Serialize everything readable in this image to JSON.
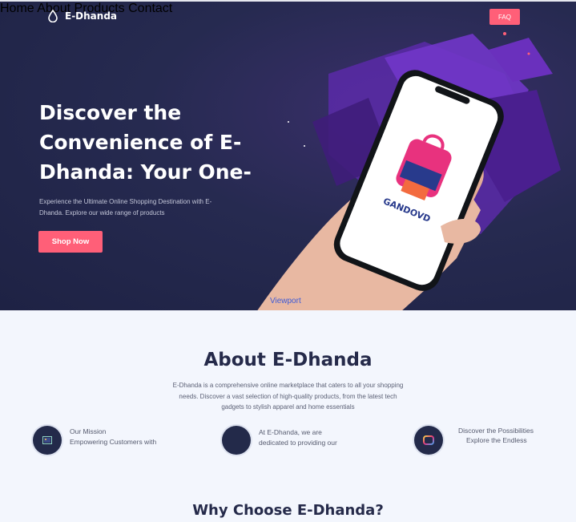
{
  "header": {
    "brand": "E-Dhanda",
    "nav": [
      "Home",
      "About",
      "Products",
      "Contact"
    ],
    "faq": "FAQ"
  },
  "hero": {
    "title": "Discover the Convenience of E-Dhanda: Your One-",
    "subtitle": "Experience the Ultimate Online Shopping Destination with E-Dhanda. Explore our wide range of products",
    "cta": "Shop Now",
    "viewport_label": "Viewport"
  },
  "about": {
    "title": "About E-Dhanda",
    "text": "E-Dhanda is a comprehensive online marketplace that caters to all your shopping needs. Discover a vast selection of high-quality products, from the latest tech gadgets to stylish apparel and home essentials",
    "features": [
      {
        "title": "Our Mission",
        "text": "Empowering Customers with",
        "icon": "image-icon"
      },
      {
        "title": "At E-Dhanda, we are",
        "text": "dedicated to providing our",
        "icon": "circle-icon"
      },
      {
        "title": "Discover the Possibilities",
        "text": "Explore the Endless",
        "icon": "gradient-square-icon"
      }
    ]
  },
  "why": {
    "title": "Why Choose E-Dhanda?"
  },
  "colors": {
    "accent": "#ff5f78",
    "hero_bg": "#262a50",
    "heading": "#252a4a",
    "page_bg": "#f3f6fd"
  }
}
